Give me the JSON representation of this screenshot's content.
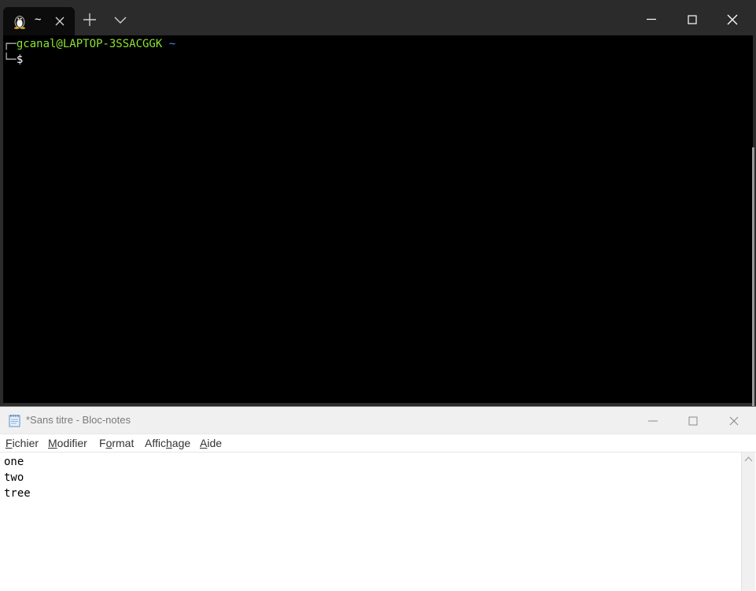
{
  "terminal": {
    "tab": {
      "title": "~",
      "icon": "linux-penguin-icon"
    },
    "toolbar": {
      "new_tab_icon": "plus-icon",
      "dropdown_icon": "chevron-down-icon"
    },
    "window_controls": [
      "minimize-icon",
      "maximize-icon",
      "close-icon"
    ],
    "prompt": {
      "frame_top": "┌─",
      "user_host": "gcanal@LAPTOP-3SSACGGK",
      "path": "~",
      "frame_bottom": "└─",
      "symbol": "$"
    }
  },
  "notepad": {
    "title": "*Sans titre - Bloc-notes",
    "icon": "notepad-icon",
    "menu": {
      "fichier": {
        "before": "",
        "key": "F",
        "after": "ichier"
      },
      "modifier": {
        "before": "",
        "key": "M",
        "after": "odifier"
      },
      "format": {
        "before": "F",
        "key": "o",
        "after": "rmat"
      },
      "affichage": {
        "before": "Affic",
        "key": "h",
        "after": "age"
      },
      "aide": {
        "before": "",
        "key": "A",
        "after": "ide"
      }
    },
    "content_lines": [
      "one",
      "two",
      "tree"
    ]
  },
  "colors": {
    "titlebar_dark": "#2b2b2b",
    "terminal_bg": "#000000",
    "prompt_user": "#8ae234",
    "prompt_path": "#3b8eea",
    "notepad_title_text": "#7a7a7a"
  }
}
